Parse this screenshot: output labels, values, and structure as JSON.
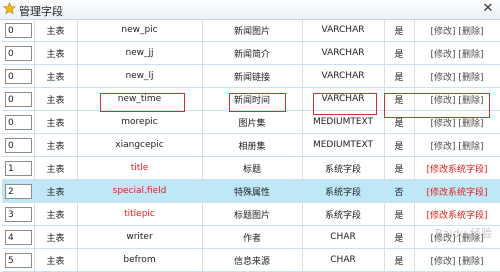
{
  "window": {
    "title": "管理字段",
    "title_icon": "star-icon",
    "close_glyph": "✕"
  },
  "rows": [
    {
      "order": "0",
      "table": "主表",
      "field": "new_pic",
      "label": "新闻图片",
      "type": "VARCHAR",
      "flag": "是",
      "action": "[修改] [删除]",
      "kind": "normal"
    },
    {
      "order": "0",
      "table": "主表",
      "field": "new_jj",
      "label": "新闻简介",
      "type": "VARCHAR",
      "flag": "是",
      "action": "[修改] [删除]",
      "kind": "normal"
    },
    {
      "order": "0",
      "table": "主表",
      "field": "new_lj",
      "label": "新闻链接",
      "type": "VARCHAR",
      "flag": "是",
      "action": "[修改] [删除]",
      "kind": "normal"
    },
    {
      "order": "0",
      "table": "主表",
      "field": "new_time",
      "label": "新闻时间",
      "type": "VARCHAR",
      "flag": "是",
      "action": "[修改] [删除]",
      "kind": "normal"
    },
    {
      "order": "0",
      "table": "主表",
      "field": "morepic",
      "label": "图片集",
      "type": "MEDIUMTEXT",
      "flag": "是",
      "action": "[修改] [删除]",
      "kind": "normal"
    },
    {
      "order": "0",
      "table": "主表",
      "field": "xiangcepic",
      "label": "相册集",
      "type": "MEDIUMTEXT",
      "flag": "是",
      "action": "[修改] [删除]",
      "kind": "normal"
    },
    {
      "order": "1",
      "table": "主表",
      "field": "title",
      "label": "标题",
      "type": "系统字段",
      "flag": "是",
      "action": "[修改系统字段]",
      "kind": "sys"
    },
    {
      "order": "2",
      "table": "主表",
      "field": "special.field",
      "label": "特殊属性",
      "type": "系统字段",
      "flag": "否",
      "action": "[修改系统字段]",
      "kind": "sys-sel"
    },
    {
      "order": "3",
      "table": "主表",
      "field": "titlepic",
      "label": "标题图片",
      "type": "系统字段",
      "flag": "是",
      "action": "[修改系统字段]",
      "kind": "sys"
    },
    {
      "order": "4",
      "table": "主表",
      "field": "writer",
      "label": "作者",
      "type": "CHAR",
      "flag": "是",
      "action": "[修改] [删除]",
      "kind": "normal"
    },
    {
      "order": "5",
      "table": "主表",
      "field": "befrom",
      "label": "信息来源",
      "type": "CHAR",
      "flag": "是",
      "action": "[修改] [删除]",
      "kind": "normal"
    }
  ],
  "watermark": "Baidu 经验"
}
